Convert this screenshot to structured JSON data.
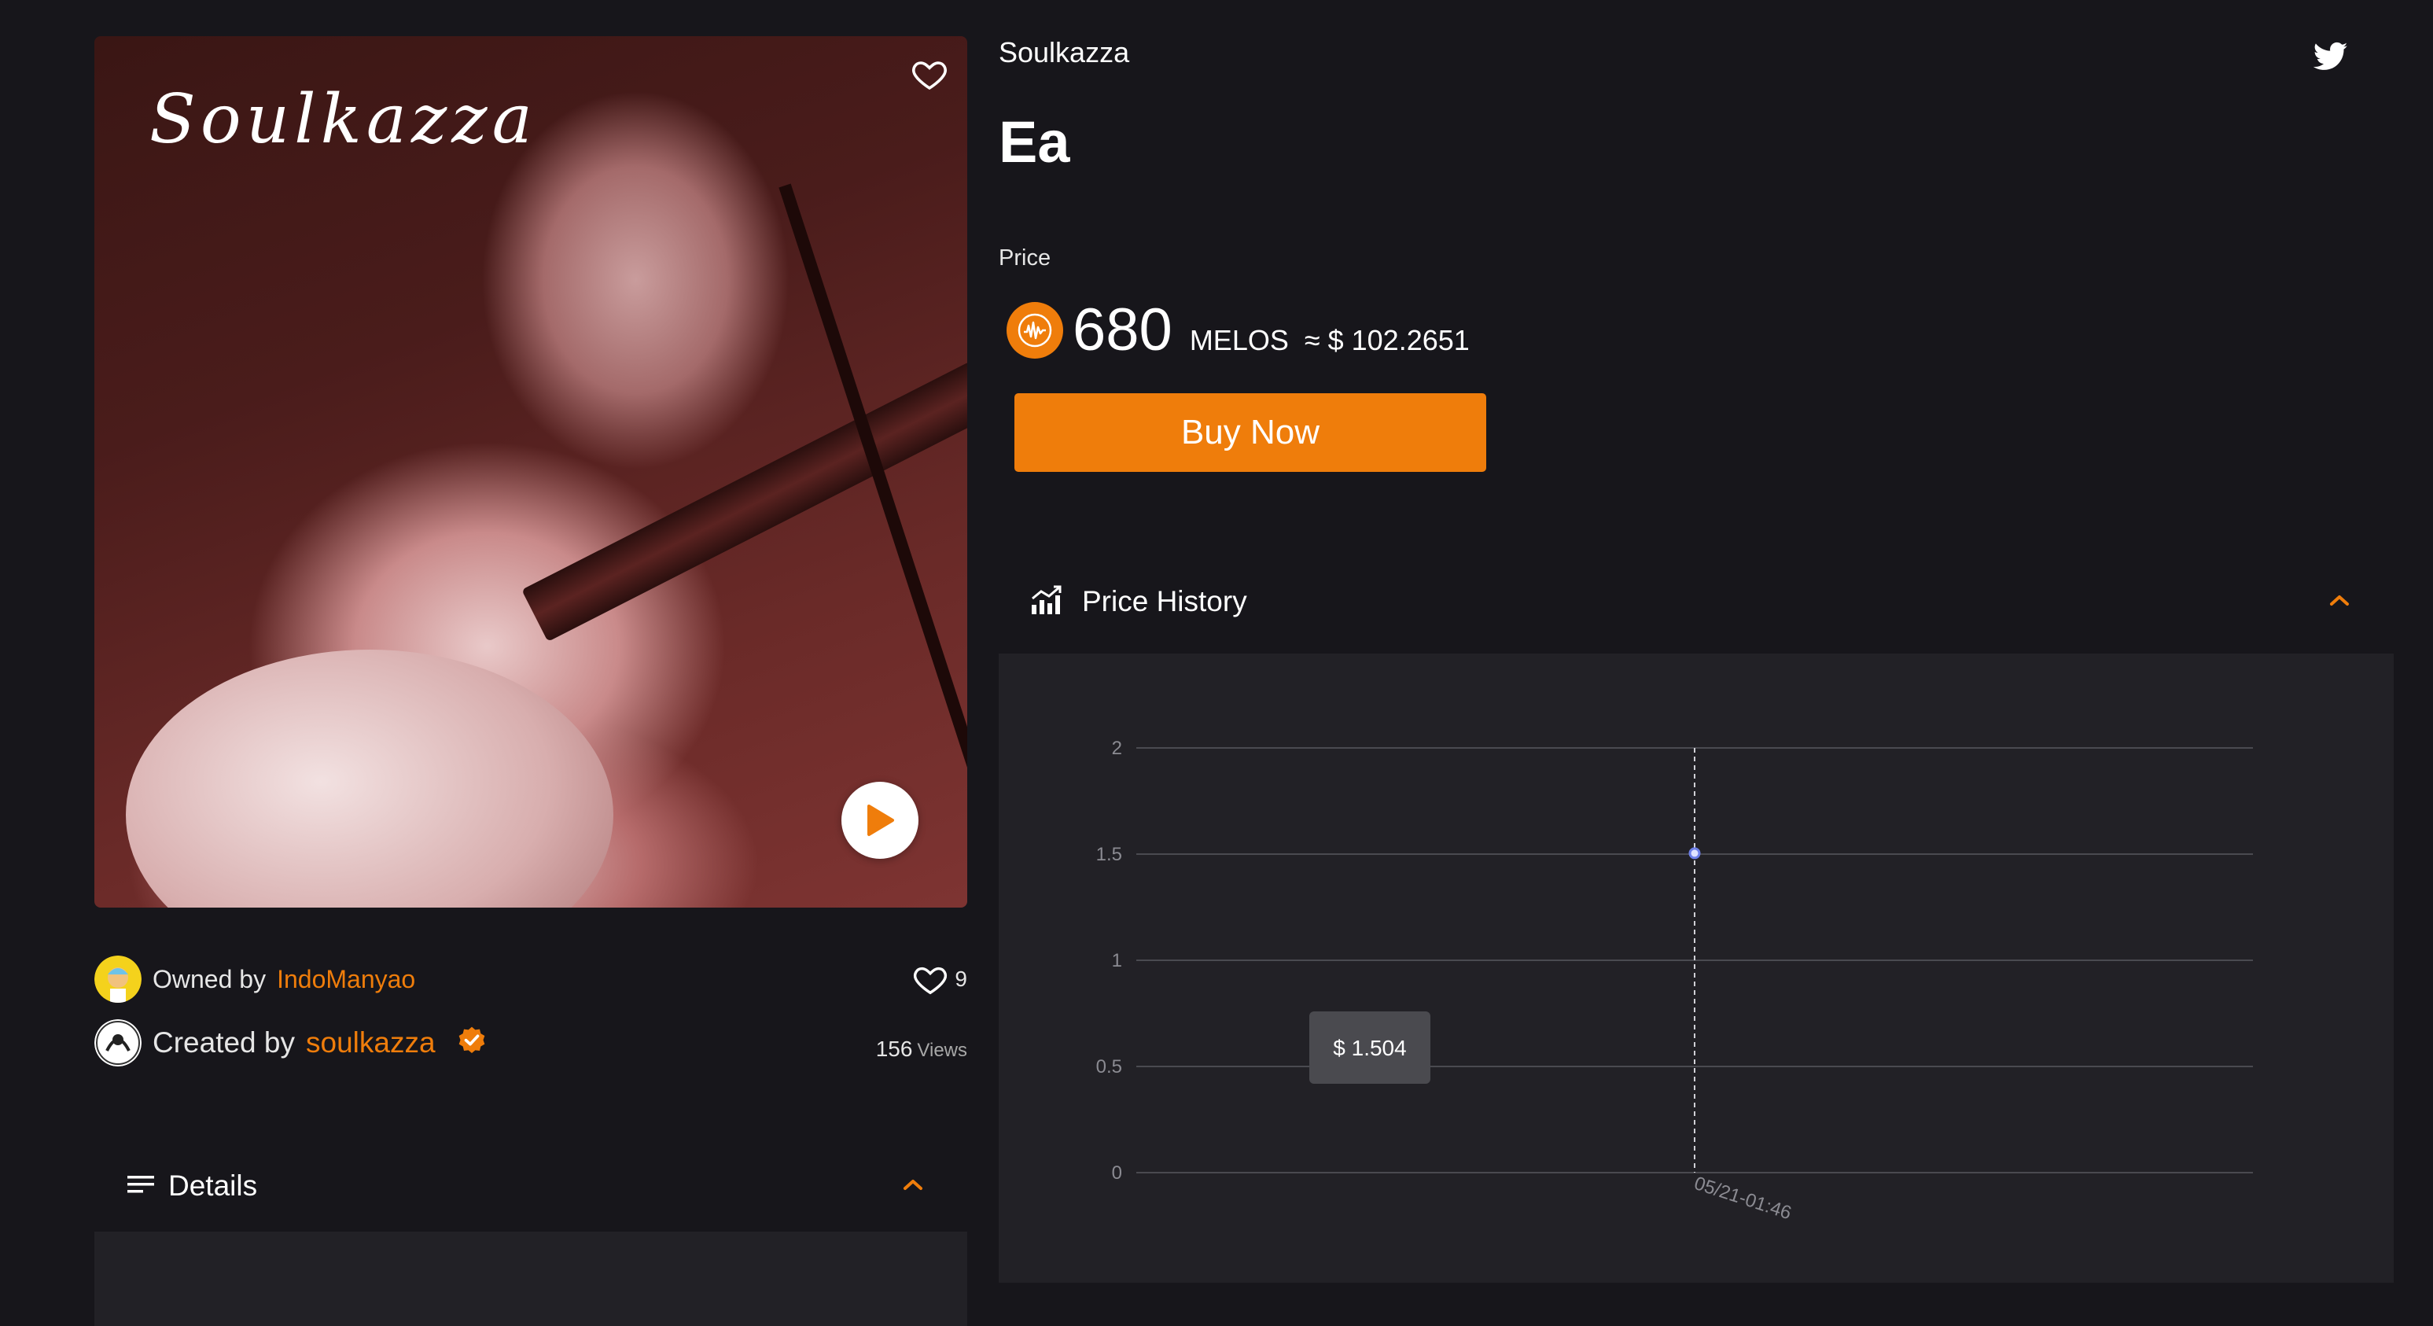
{
  "artwork": {
    "script_title": "Soulkazza",
    "heart_icon": "heart-outline-icon",
    "play_icon": "play-icon"
  },
  "owner": {
    "prefix": "Owned by",
    "name": "IndoManyao"
  },
  "creator": {
    "prefix": "Created by",
    "name": "soulkazza",
    "verified_icon": "verified-badge-icon"
  },
  "stats": {
    "likes": "9",
    "views": "156",
    "views_label": "Views"
  },
  "details": {
    "title": "Details",
    "icon": "list-icon",
    "toggle_icon": "chevron-up-icon"
  },
  "collection": "Soulkazza",
  "item_title": "Ea",
  "price": {
    "label": "Price",
    "amount": "680",
    "unit": "MELOS",
    "usd": "≈ $ 102.2651"
  },
  "buy_label": "Buy Now",
  "price_history": {
    "title": "Price History",
    "icon": "trending-chart-icon",
    "toggle_icon": "chevron-up-icon"
  },
  "colors": {
    "accent": "#ef7d0b",
    "background": "#17161b",
    "panel": "#222126"
  },
  "chart_data": {
    "type": "line",
    "x": [
      "05/21-01:46"
    ],
    "series": [
      {
        "values": [
          1.504
        ]
      }
    ],
    "y_ticks": [
      "0",
      "0.5",
      "1",
      "1.5",
      "2"
    ],
    "ylim": [
      0,
      2
    ],
    "grid": true,
    "tooltip": "$ 1.504"
  }
}
